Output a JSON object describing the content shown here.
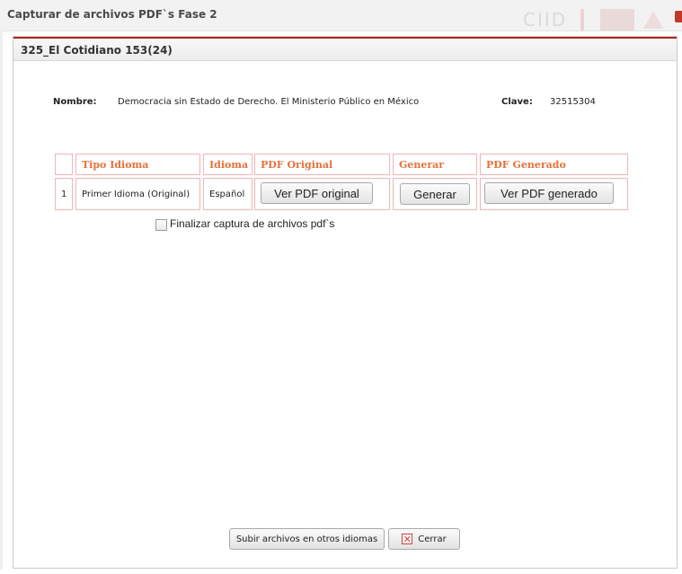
{
  "window": {
    "title": "Capturar de archivos PDF`s Fase 2",
    "bg_logo_text": "CIID"
  },
  "dialog": {
    "title": "325_El Cotidiano 153(24)",
    "nombre_label": "Nombre:",
    "nombre_value": "Democracia sin Estado de Derecho. El Ministerio Público en México",
    "clave_label": "Clave:",
    "clave_value": "32515304"
  },
  "table": {
    "headers": [
      "",
      "Tipo Idioma",
      "Idioma",
      "PDF Original",
      "Generar",
      "PDF Generado"
    ],
    "rows": [
      {
        "num": "1",
        "tipo": "Primer Idioma (Original)",
        "idioma": "Español",
        "ver_original": "Ver PDF original",
        "generar": "Generar",
        "ver_generado": "Ver PDF generado"
      }
    ]
  },
  "finalizar": {
    "label": "Finalizar captura de archivos pdf`s",
    "checked": false
  },
  "footer": {
    "subir_label": "Subir archivos en otros idiomas",
    "cerrar_label": "Cerrar"
  },
  "colors": {
    "header_text": "#e8703a",
    "cell_border": "#f0b6b6",
    "accent_red": "#b22222"
  },
  "icons": {
    "close_button_icon": "red-x-icon",
    "window_close_icon": "window-close-icon"
  }
}
